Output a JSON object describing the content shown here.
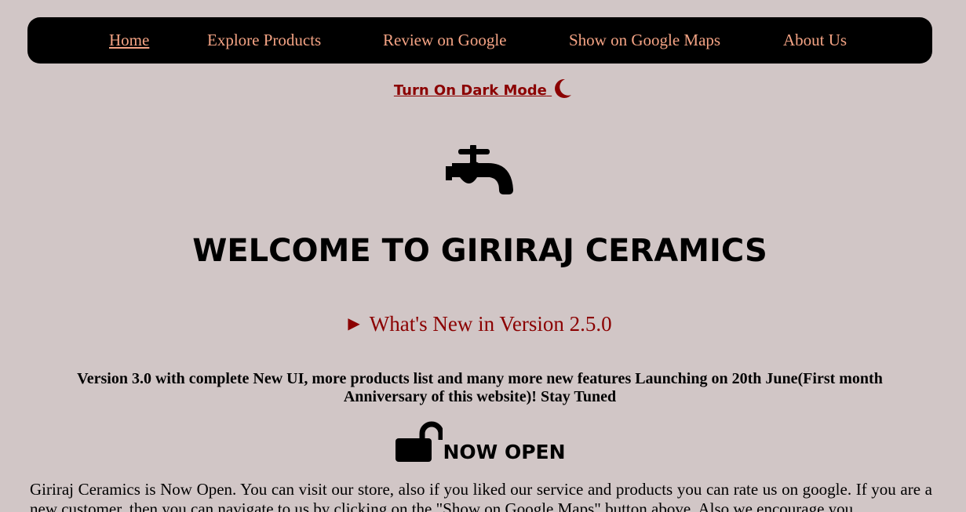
{
  "nav": {
    "items": [
      {
        "label": "Home",
        "active": true
      },
      {
        "label": "Explore Products"
      },
      {
        "label": "Review on Google"
      },
      {
        "label": "Show on Google Maps"
      },
      {
        "label": "About Us"
      }
    ]
  },
  "dark_mode": {
    "label": "Turn On Dark Mode",
    "icon": "moon-icon"
  },
  "logo": {
    "icon": "faucet-icon"
  },
  "welcome_title": "WELCOME TO GIRIRAJ CERAMICS",
  "whats_new": {
    "label": "What's New in Version 2.5.0",
    "icon": "triangle-right-icon"
  },
  "announcement": "Version 3.0 with complete New UI, more products list and many more new features Launching on 20th June(First month Anniversary of this website)! Stay Tuned",
  "status": {
    "heading": "NOW OPEN",
    "icon": "unlock-icon",
    "text": "Giriraj Ceramics is Now Open. You can visit our store, also if you liked our service and products you can rate us on google. If you are a new customer, then you can navigate to us by clicking on the \"Show on Google Maps\" button above. Also we encourage you"
  },
  "colors": {
    "background": "#d1c6c6",
    "navbar": "#000000",
    "nav_link": "#f4a384",
    "accent": "#8b0000"
  }
}
